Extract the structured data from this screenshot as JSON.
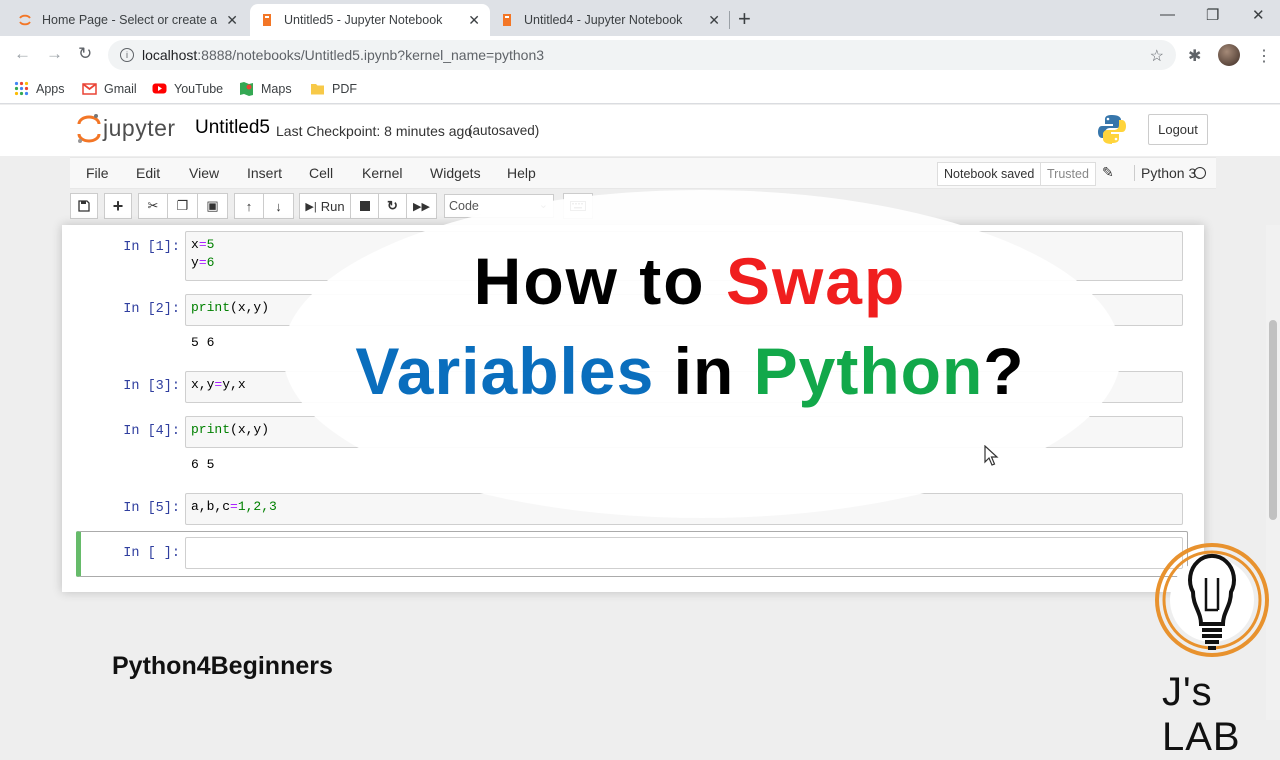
{
  "browser": {
    "tabs": [
      {
        "title": "Home Page - Select or create a no",
        "active": false
      },
      {
        "title": "Untitled5 - Jupyter Notebook",
        "active": true
      },
      {
        "title": "Untitled4 - Jupyter Notebook",
        "active": false
      }
    ],
    "url_host": "localhost",
    "url_rest": ":8888/notebooks/Untitled5.ipynb?kernel_name=python3",
    "bookmarks": [
      "Apps",
      "Gmail",
      "YouTube",
      "Maps",
      "PDF"
    ]
  },
  "jupyter": {
    "logo_text": "jupyter",
    "notebook_name": "Untitled5",
    "checkpoint": "Last Checkpoint: 8 minutes ago",
    "autosave": "(autosaved)",
    "logout": "Logout",
    "menu": [
      "File",
      "Edit",
      "View",
      "Insert",
      "Cell",
      "Kernel",
      "Widgets",
      "Help"
    ],
    "notebook_status": "Notebook saved",
    "trusted": "Trusted",
    "kernel_name": "Python 3",
    "run_label": "Run",
    "cell_type": "Code"
  },
  "cells": [
    {
      "prompt": "In [1]:",
      "output": ""
    },
    {
      "prompt": "In [2]:",
      "output": "5 6"
    },
    {
      "prompt": "In [3]:",
      "output": ""
    },
    {
      "prompt": "In [4]:",
      "output": "6 5"
    },
    {
      "prompt": "In [5]:",
      "output": ""
    },
    {
      "prompt": "In [ ]:",
      "output": ""
    }
  ],
  "code": {
    "c1_l1_var": "x",
    "c1_l1_op": "=",
    "c1_l1_num": "5",
    "c1_l2_var": "y",
    "c1_l2_op": "=",
    "c1_l2_num": "6",
    "c2_fn": "print",
    "c2_args": "(x,y)",
    "c3_lhs": "x,y",
    "c3_op": "=",
    "c3_rhs": "y,x",
    "c4_fn": "print",
    "c4_args": "(x,y)",
    "c5_lhs": "a,b,c",
    "c5_op": "=",
    "c5_rhs": "1,2,3"
  },
  "overlay": {
    "line1_a": "How to ",
    "line1_b": "Swap",
    "line2_a": "Variables",
    "line2_b": " in ",
    "line2_c": "Python",
    "line2_d": "?",
    "brand": "Python4Beginners",
    "logo_text": "J's LAB",
    "colors": {
      "red": "#f01e1e",
      "blue": "#0a6ebd",
      "green": "#12a84a",
      "orange": "#e8922e"
    }
  }
}
